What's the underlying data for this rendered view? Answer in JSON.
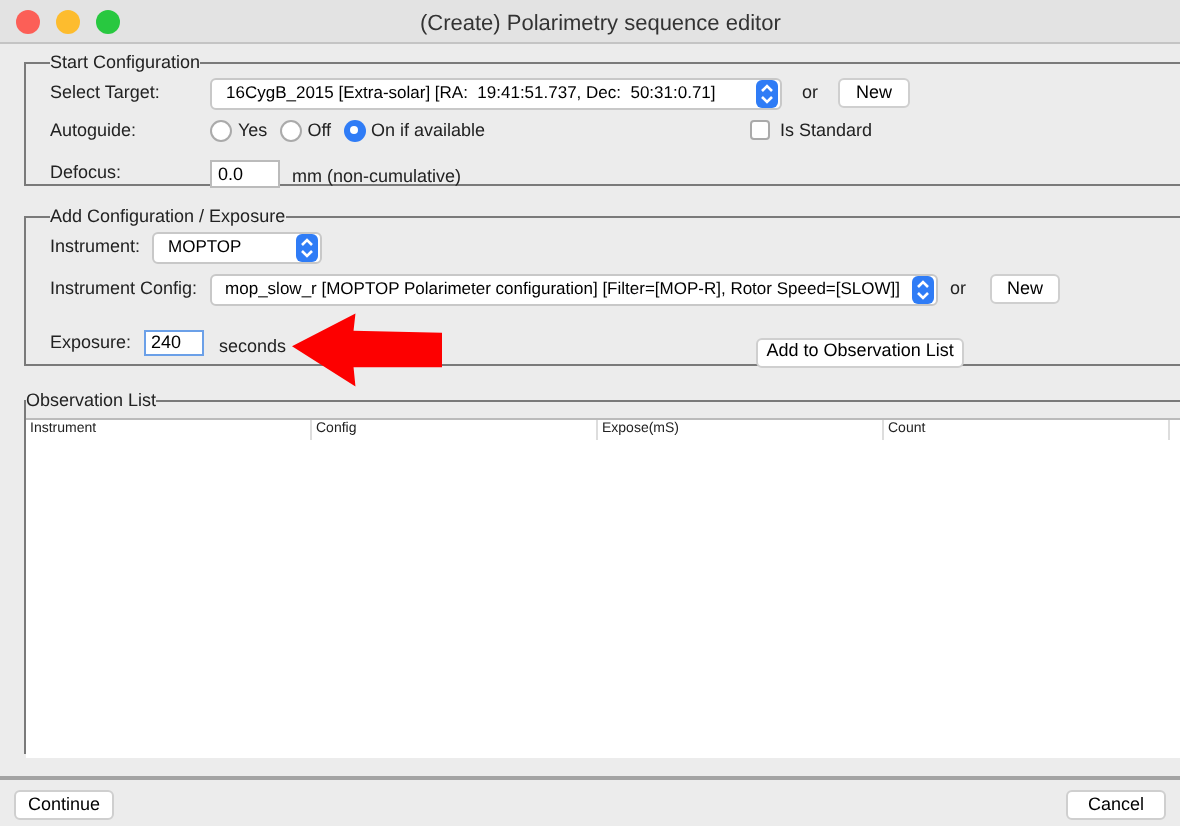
{
  "window": {
    "title": "(Create) Polarimetry sequence editor"
  },
  "start_configuration": {
    "title": "Start Configuration",
    "target_label": "Select Target:",
    "target_value": "16CygB_2015 [Extra-solar] [RA:  19:41:51.737, Dec:  50:31:0.71]",
    "or_label": "or",
    "new_button": "New",
    "autoguide_label": "Autoguide:",
    "autoguide_options": [
      {
        "label": "Yes",
        "selected": false
      },
      {
        "label": "Off",
        "selected": false
      },
      {
        "label": "On if available",
        "selected": true
      }
    ],
    "is_standard": {
      "label": "Is Standard",
      "checked": false
    },
    "defocus_label": "Defocus:",
    "defocus_value": "0.0",
    "defocus_unit": "mm (non-cumulative)"
  },
  "add_configuration": {
    "title": "Add Configuration / Exposure",
    "instrument_label": "Instrument:",
    "instrument_value": "MOPTOP",
    "config_label": "Instrument Config:",
    "config_value": "mop_slow_r [MOPTOP Polarimeter configuration] [Filter=[MOP-R], Rotor Speed=[SLOW]]",
    "or_label": "or",
    "new_button": "New",
    "exposure_label": "Exposure:",
    "exposure_value": "240",
    "exposure_unit": "seconds",
    "add_button": "Add to Observation List"
  },
  "observation_list": {
    "title": "Observation List",
    "columns": [
      "Instrument",
      "Config",
      "Expose(mS)",
      "Count"
    ]
  },
  "buttons": [
    {
      "label": "Continue"
    },
    {
      "label": "Cancel"
    }
  ]
}
